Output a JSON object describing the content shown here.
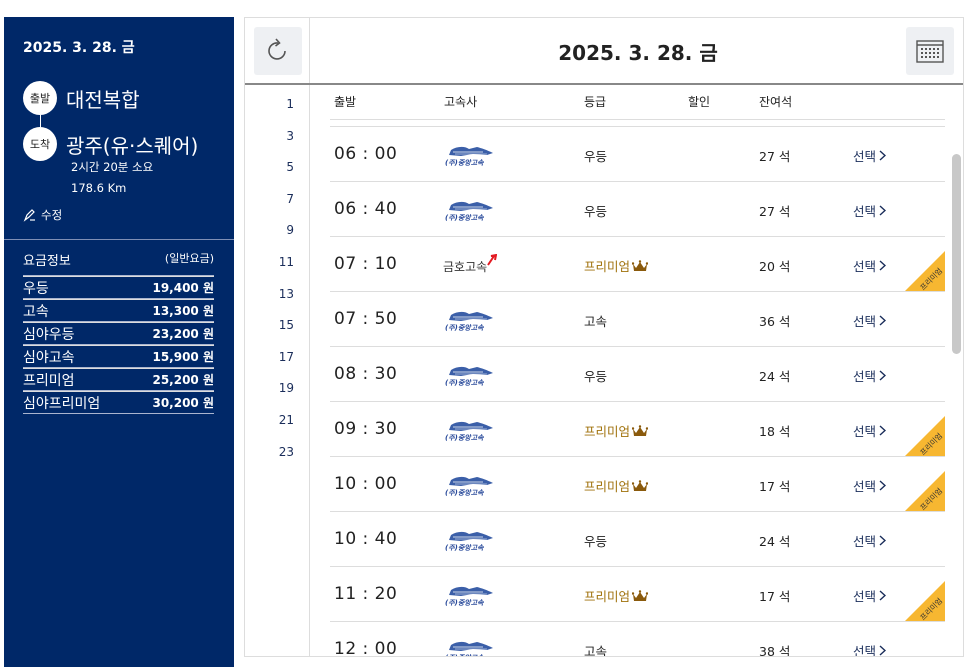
{
  "sidebar": {
    "date": "2025. 3. 28. 금",
    "depart_label": "출발",
    "depart_name": "대전복합",
    "arrive_label": "도착",
    "arrive_name": "광주(유·스퀘어)",
    "duration": "2시간 20분 소요",
    "distance": "178.6 Km",
    "edit_label": "수정",
    "fare_title": "요금정보",
    "fare_type": "(일반요금)",
    "fares": [
      {
        "grade": "우등",
        "price": "19,400 원"
      },
      {
        "grade": "고속",
        "price": "13,300 원"
      },
      {
        "grade": "심야우등",
        "price": "23,200 원"
      },
      {
        "grade": "심야고속",
        "price": "15,900 원"
      },
      {
        "grade": "프리미엄",
        "price": "25,200 원"
      },
      {
        "grade": "심야프리미엄",
        "price": "30,200 원"
      }
    ]
  },
  "header": {
    "date": "2025. 3. 28. 금"
  },
  "hours": [
    "1",
    "3",
    "5",
    "7",
    "9",
    "11",
    "13",
    "15",
    "17",
    "19",
    "21",
    "23"
  ],
  "table": {
    "columns": {
      "depart": "출발",
      "company": "고속사",
      "grade": "등급",
      "discount": "할인",
      "seats": "잔여석"
    },
    "rows": [
      {
        "time": "06 : 00",
        "company": "중앙고속",
        "grade": "우등",
        "premium": false,
        "seats": "27 석",
        "select": "선택"
      },
      {
        "time": "06 : 40",
        "company": "중앙고속",
        "grade": "우등",
        "premium": false,
        "seats": "27 석",
        "select": "선택"
      },
      {
        "time": "07 : 10",
        "company": "금호고속",
        "grade": "프리미엄",
        "premium": true,
        "seats": "20 석",
        "select": "선택"
      },
      {
        "time": "07 : 50",
        "company": "중앙고속",
        "grade": "고속",
        "premium": false,
        "seats": "36 석",
        "select": "선택"
      },
      {
        "time": "08 : 30",
        "company": "중앙고속",
        "grade": "우등",
        "premium": false,
        "seats": "24 석",
        "select": "선택"
      },
      {
        "time": "09 : 30",
        "company": "중앙고속",
        "grade": "프리미엄",
        "premium": true,
        "seats": "18 석",
        "select": "선택"
      },
      {
        "time": "10 : 00",
        "company": "중앙고속",
        "grade": "프리미엄",
        "premium": true,
        "seats": "17 석",
        "select": "선택"
      },
      {
        "time": "10 : 40",
        "company": "중앙고속",
        "grade": "우등",
        "premium": false,
        "seats": "24 석",
        "select": "선택"
      },
      {
        "time": "11 : 20",
        "company": "중앙고속",
        "grade": "프리미엄",
        "premium": true,
        "seats": "17 석",
        "select": "선택"
      },
      {
        "time": "12 : 00",
        "company": "중앙고속",
        "grade": "고속",
        "premium": false,
        "seats": "38 석",
        "select": "선택"
      }
    ],
    "premium_ribbon": "프리미엄"
  },
  "colors": {
    "sidebar_bg": "#002868",
    "premium_text": "#a0720c",
    "ribbon": "#f7b731",
    "link": "#1a2d5a"
  }
}
